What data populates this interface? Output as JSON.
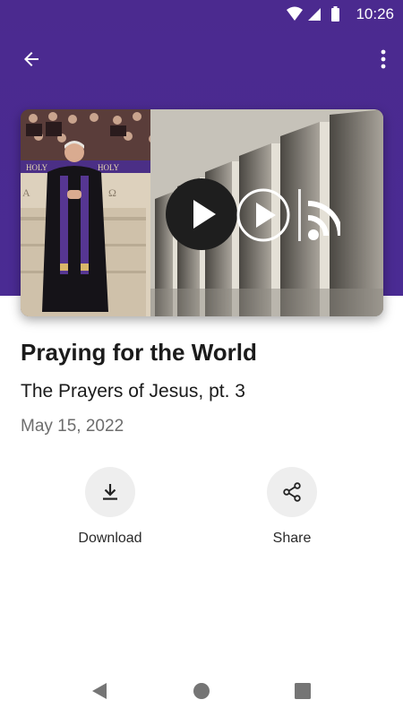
{
  "status_bar": {
    "time": "10:26",
    "icons": [
      "wifi-icon",
      "cellular-signal-icon",
      "battery-icon"
    ]
  },
  "app_bar": {
    "back_icon": "arrow-back-icon",
    "menu_icon": "more-vertical-icon"
  },
  "media": {
    "thumbnail": "sermon-video-thumbnail",
    "play_icon": "play-icon",
    "stream_icon": "play-cast-icon"
  },
  "episode": {
    "title": "Praying for the World",
    "series": "The Prayers of Jesus, pt. 3",
    "date": "May 15, 2022"
  },
  "actions": [
    {
      "label": "Download",
      "icon": "download-icon"
    },
    {
      "label": "Share",
      "icon": "share-icon"
    }
  ],
  "nav_bar": {
    "icons": [
      "nav-back-icon",
      "nav-home-icon",
      "nav-recents-icon"
    ]
  },
  "colors": {
    "header": "#4a2b93",
    "text_primary": "#1b1b1b",
    "text_secondary": "#6d6d6d",
    "action_circle": "#eeeeee"
  }
}
